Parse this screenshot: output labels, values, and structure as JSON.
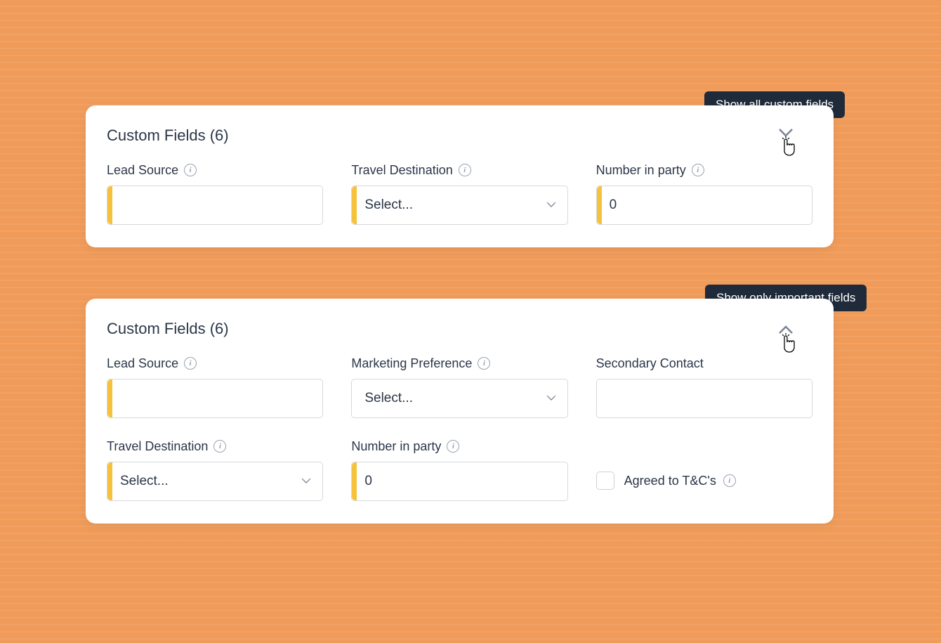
{
  "tooltips": {
    "show_all": "Show all custom fields",
    "show_important": "Show only important fields"
  },
  "panel1": {
    "title": "Custom Fields (6)",
    "fields": {
      "lead_source": {
        "label": "Lead Source",
        "value": ""
      },
      "travel_destination": {
        "label": "Travel Destination",
        "placeholder": "Select..."
      },
      "number_in_party": {
        "label": "Number in party",
        "value": "0"
      }
    }
  },
  "panel2": {
    "title": "Custom Fields (6)",
    "fields": {
      "lead_source": {
        "label": "Lead Source",
        "value": ""
      },
      "marketing_preference": {
        "label": "Marketing Preference",
        "placeholder": "Select..."
      },
      "secondary_contact": {
        "label": "Secondary Contact",
        "value": ""
      },
      "travel_destination": {
        "label": "Travel Destination",
        "placeholder": "Select..."
      },
      "number_in_party": {
        "label": "Number in party",
        "value": "0"
      },
      "agreed_tcs": {
        "label": "Agreed to T&C's",
        "checked": false
      }
    }
  }
}
